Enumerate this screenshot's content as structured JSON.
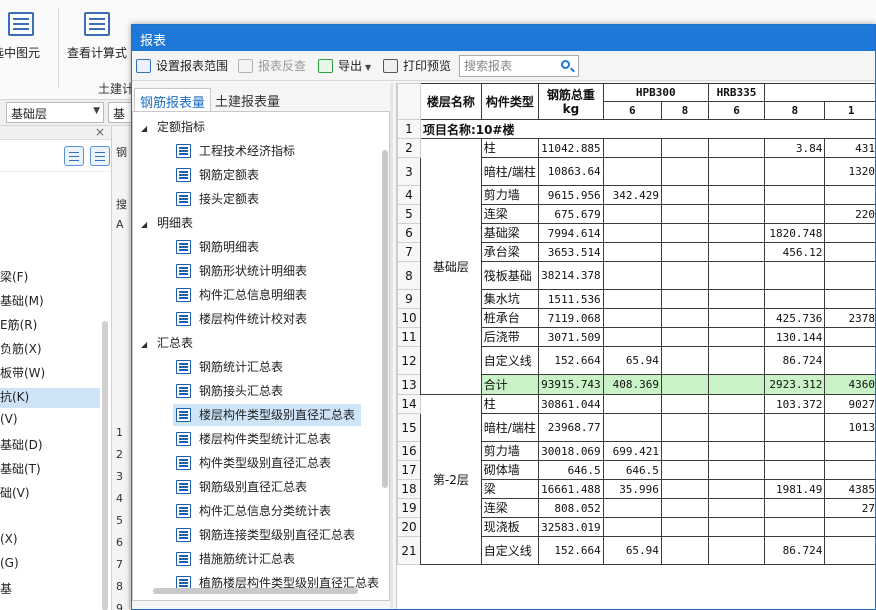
{
  "ribbon": {
    "select_in_graph_label": "选中图元",
    "view_formula_label": "查看计算式",
    "group_label": "土建计"
  },
  "combos": {
    "floor_value": "基础层",
    "second_value": "基"
  },
  "left_panel": {
    "items": [
      "梁(F)",
      "基础(M)",
      "E筋(R)",
      "负筋(X)",
      "板带(W)",
      "抗(K)",
      "(V)",
      "基础(D)",
      "基础(T)",
      "础(V)",
      "(X)",
      "(G)",
      "基"
    ]
  },
  "mid_strip": {
    "chars": [
      "钢",
      "搜",
      "A",
      "1",
      "2",
      "3",
      "4",
      "5",
      "6",
      "7",
      "8",
      "9"
    ]
  },
  "dialog": {
    "title": "报表",
    "toolbar": {
      "set_scope_label": "设置报表范围",
      "reverse_check_label": "报表反查",
      "export_label": "导出",
      "print_preview_label": "打印预览",
      "search_placeholder": "搜索报表"
    },
    "tabs": {
      "rebar_tab": "钢筋报表量",
      "civil_tab": "土建报表量"
    },
    "tree": [
      {
        "group": "定额指标",
        "items": [
          "工程技术经济指标",
          "钢筋定额表",
          "接头定额表"
        ]
      },
      {
        "group": "明细表",
        "items": [
          "钢筋明细表",
          "钢筋形状统计明细表",
          "构件汇总信息明细表",
          "楼层构件统计校对表"
        ]
      },
      {
        "group": "汇总表",
        "items": [
          "钢筋统计汇总表",
          "钢筋接头汇总表",
          "楼层构件类型级别直径汇总表",
          "楼层构件类型统计汇总表",
          "构件类型级别直径汇总表",
          "钢筋级别直径汇总表",
          "构件汇总信息分类统计表",
          "钢筋连接类型级别直径汇总表",
          "措施筋统计汇总表",
          "植筋楼层构件类型级别直径汇总表"
        ]
      }
    ],
    "selected_item": "楼层构件类型级别直径汇总表"
  },
  "table": {
    "headers": {
      "floor_name": "楼层名称",
      "component_type": "构件类型",
      "rebar_total_line1": "钢筋总重",
      "rebar_total_unit": "kg",
      "hpb300": "HPB300",
      "hrb335": "HRB335",
      "hpb_cols": [
        "6",
        "8"
      ],
      "hrb_cols": [
        "6",
        "8",
        "1"
      ]
    },
    "project_name": "项目名称:10#楼",
    "floors": [
      "基础层",
      "第-2层"
    ],
    "rows": [
      {
        "n": "2",
        "type": "柱",
        "total": "11042.885",
        "c1": "",
        "c2": "",
        "c3": "",
        "c4": "3.84",
        "c5": "431"
      },
      {
        "n": "3",
        "type": "暗柱/端柱",
        "total": "10863.64",
        "c1": "",
        "c2": "",
        "c3": "",
        "c4": "",
        "c5": "1320"
      },
      {
        "n": "4",
        "type": "剪力墙",
        "total": "9615.956",
        "c1": "342.429",
        "c2": "",
        "c3": "",
        "c4": "",
        "c5": ""
      },
      {
        "n": "5",
        "type": "连梁",
        "total": "675.679",
        "c1": "",
        "c2": "",
        "c3": "",
        "c4": "",
        "c5": "220"
      },
      {
        "n": "6",
        "type": "基础梁",
        "total": "7994.614",
        "c1": "",
        "c2": "",
        "c3": "",
        "c4": "1820.748",
        "c5": ""
      },
      {
        "n": "7",
        "type": "承台梁",
        "total": "3653.514",
        "c1": "",
        "c2": "",
        "c3": "",
        "c4": "456.12",
        "c5": ""
      },
      {
        "n": "8",
        "type": "筏板基础",
        "total": "38214.378",
        "c1": "",
        "c2": "",
        "c3": "",
        "c4": "",
        "c5": ""
      },
      {
        "n": "9",
        "type": "集水坑",
        "total": "1511.536",
        "c1": "",
        "c2": "",
        "c3": "",
        "c4": "",
        "c5": ""
      },
      {
        "n": "10",
        "type": "桩承台",
        "total": "7119.068",
        "c1": "",
        "c2": "",
        "c3": "",
        "c4": "425.736",
        "c5": "2378"
      },
      {
        "n": "11",
        "type": "后浇带",
        "total": "3071.509",
        "c1": "",
        "c2": "",
        "c3": "",
        "c4": "130.144",
        "c5": ""
      },
      {
        "n": "12",
        "type": "自定义线",
        "total": "152.664",
        "c1": "65.94",
        "c2": "",
        "c3": "",
        "c4": "86.724",
        "c5": ""
      },
      {
        "n": "13",
        "type": "合计",
        "total": "93915.743",
        "c1": "408.369",
        "c2": "",
        "c3": "",
        "c4": "2923.312",
        "c5": "4360"
      },
      {
        "n": "14",
        "type": "柱",
        "total": "30861.044",
        "c1": "",
        "c2": "",
        "c3": "",
        "c4": "103.372",
        "c5": "9027"
      },
      {
        "n": "15",
        "type": "暗柱/端柱",
        "total": "23968.77",
        "c1": "",
        "c2": "",
        "c3": "",
        "c4": "",
        "c5": "1013"
      },
      {
        "n": "16",
        "type": "剪力墙",
        "total": "30018.069",
        "c1": "699.421",
        "c2": "",
        "c3": "",
        "c4": "",
        "c5": ""
      },
      {
        "n": "17",
        "type": "砌体墙",
        "total": "646.5",
        "c1": "646.5",
        "c2": "",
        "c3": "",
        "c4": "",
        "c5": ""
      },
      {
        "n": "18",
        "type": "梁",
        "total": "16661.488",
        "c1": "35.996",
        "c2": "",
        "c3": "",
        "c4": "1981.49",
        "c5": "4385"
      },
      {
        "n": "19",
        "type": "连梁",
        "total": "808.052",
        "c1": "",
        "c2": "",
        "c3": "",
        "c4": "",
        "c5": "27"
      },
      {
        "n": "20",
        "type": "现浇板",
        "total": "32583.019",
        "c1": "",
        "c2": "",
        "c3": "",
        "c4": "",
        "c5": ""
      },
      {
        "n": "21",
        "type": "自定义线",
        "total": "152.664",
        "c1": "65.94",
        "c2": "",
        "c3": "",
        "c4": "86.724",
        "c5": ""
      }
    ]
  },
  "colors": {
    "title_bar": "#1e78d7",
    "total_row": "#c9f3c6",
    "selection": "#cde4f9",
    "tab_active_text": "#1e6dc7"
  }
}
